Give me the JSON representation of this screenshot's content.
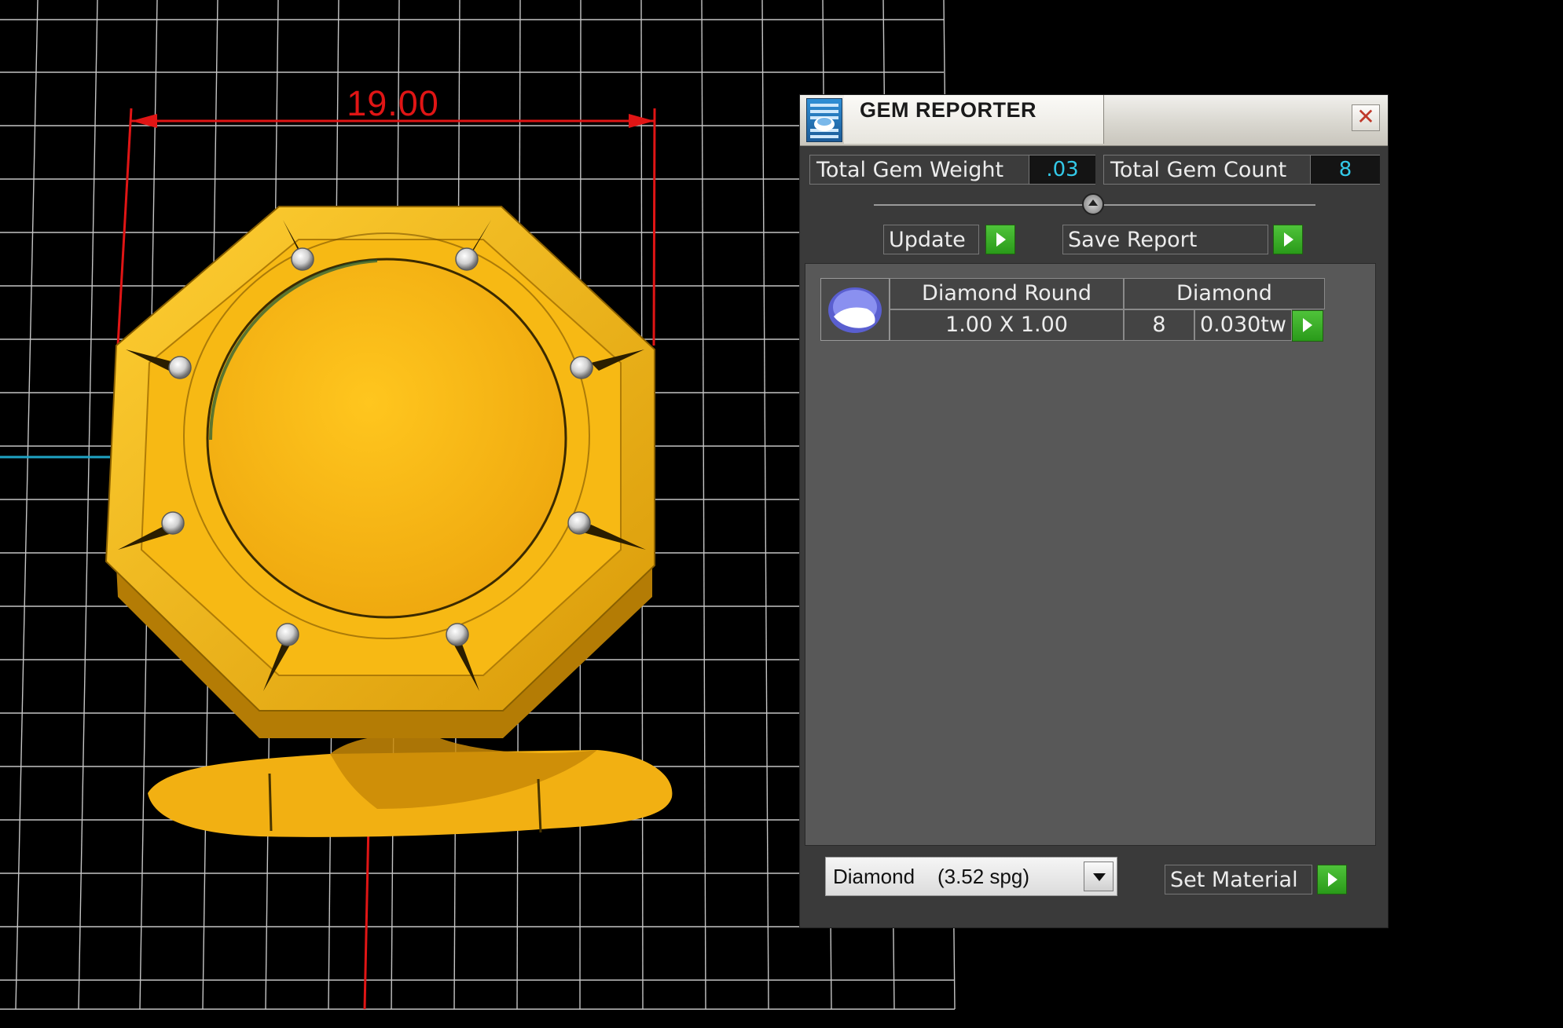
{
  "viewport": {
    "dimension_label": "19.00",
    "accent_colors": {
      "metal": "#f6b418",
      "dimension": "#e01515",
      "grid": "#cfcfcf"
    }
  },
  "panel": {
    "title": "GEM REPORTER",
    "close_icon": "close-icon",
    "total_weight_label": "Total Gem Weight",
    "total_weight_value": ".03",
    "total_count_label": "Total Gem Count",
    "total_count_value": "8",
    "update_label": "Update",
    "save_report_label": "Save Report",
    "gems": [
      {
        "name": "Diamond Round",
        "material": "Diamond",
        "size": "1.00 X 1.00",
        "count": "8",
        "weight": "0.030tw"
      }
    ],
    "material_select_value": "Diamond    (3.52 spg)",
    "set_material_label": "Set Material",
    "accent_colors": {
      "value_text": "#33c9e8",
      "go_button": "#3aaf26"
    }
  }
}
